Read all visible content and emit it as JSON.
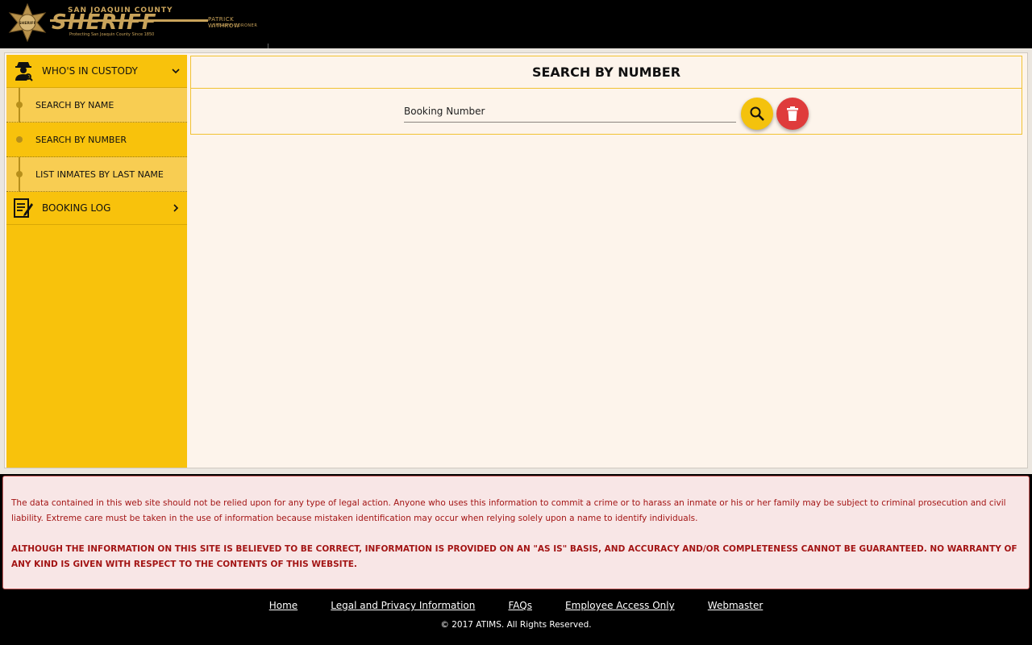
{
  "brand": {
    "county": "SAN JOAQUIN COUNTY",
    "agency": "SHERIFF",
    "badge_text": "SHERIFF",
    "tagline": "Protecting San Joaquin County Since 1850",
    "officer_name": "PATRICK WITHROW",
    "officer_title": "SHERIFF-CORONER",
    "gold": "#c9a35a"
  },
  "sidebar": {
    "accent": "#f8c20c",
    "sections": [
      {
        "label": "WHO'S IN CUSTODY",
        "icon": "detective-icon",
        "expanded": true
      },
      {
        "label": "BOOKING LOG",
        "icon": "booking-log-icon",
        "expanded": false
      }
    ],
    "sub_items": [
      {
        "label": "SEARCH BY NAME",
        "active": false
      },
      {
        "label": "SEARCH BY NUMBER",
        "active": true
      },
      {
        "label": "LIST INMATES BY LAST NAME",
        "active": false
      }
    ]
  },
  "panel": {
    "title": "SEARCH BY NUMBER",
    "input_placeholder": "Booking Number",
    "input_value": "",
    "search_button_icon": "search-icon",
    "clear_button_icon": "trash-icon",
    "search_color": "#f4c20d",
    "clear_color": "#df3b3b"
  },
  "disclaimer": {
    "paragraph1": "The data contained in this web site should not be relied upon for any type of legal action. Anyone who uses this information to commit a crime or to harass an inmate or his or her family may be subject to criminal prosecution and civil liability. Extreme care must be taken in the use of information because mistaken identification may occur when relying solely upon a name to identify individuals.",
    "paragraph2": "ALTHOUGH THE INFORMATION ON THIS SITE IS BELIEVED TO BE CORRECT, INFORMATION IS PROVIDED ON AN \"AS IS\" BASIS, AND ACCURACY AND/OR COMPLETENESS CANNOT BE GUARANTEED. NO WARRANTY OF ANY KIND IS GIVEN WITH RESPECT TO THE CONTENTS OF THIS WEBSITE."
  },
  "footer": {
    "links": [
      "Home",
      "Legal and Privacy Information",
      "FAQs",
      "Employee Access Only",
      "Webmaster"
    ],
    "copyright": "© 2017 ATIMS. All Rights Reserved."
  }
}
